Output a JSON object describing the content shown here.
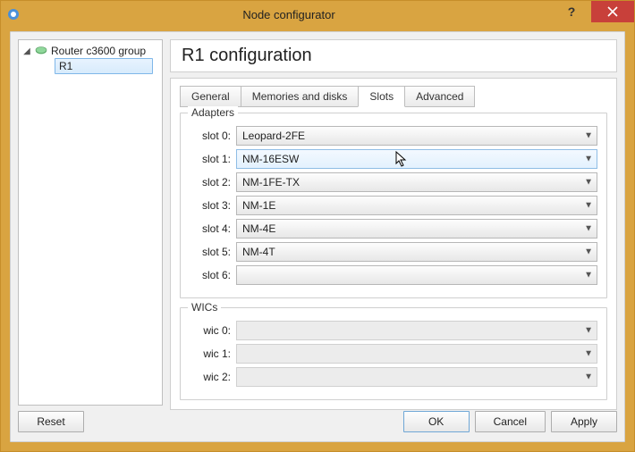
{
  "window": {
    "title": "Node configurator"
  },
  "tree": {
    "group_label": "Router c3600 group",
    "selected_node": "R1"
  },
  "header": {
    "title": "R1 configuration"
  },
  "tabs": {
    "general": "General",
    "memdisks": "Memories and disks",
    "slots": "Slots",
    "advanced": "Advanced",
    "active": "slots"
  },
  "adapters": {
    "group_title": "Adapters",
    "rows": [
      {
        "label": "slot 0:",
        "value": "Leopard-2FE"
      },
      {
        "label": "slot 1:",
        "value": "NM-16ESW"
      },
      {
        "label": "slot 2:",
        "value": "NM-1FE-TX"
      },
      {
        "label": "slot 3:",
        "value": "NM-1E"
      },
      {
        "label": "slot 4:",
        "value": "NM-4E"
      },
      {
        "label": "slot 5:",
        "value": "NM-4T"
      },
      {
        "label": "slot 6:",
        "value": ""
      }
    ]
  },
  "wics": {
    "group_title": "WICs",
    "rows": [
      {
        "label": "wic 0:",
        "value": ""
      },
      {
        "label": "wic 1:",
        "value": ""
      },
      {
        "label": "wic 2:",
        "value": ""
      }
    ]
  },
  "buttons": {
    "reset": "Reset",
    "ok": "OK",
    "cancel": "Cancel",
    "apply": "Apply"
  }
}
